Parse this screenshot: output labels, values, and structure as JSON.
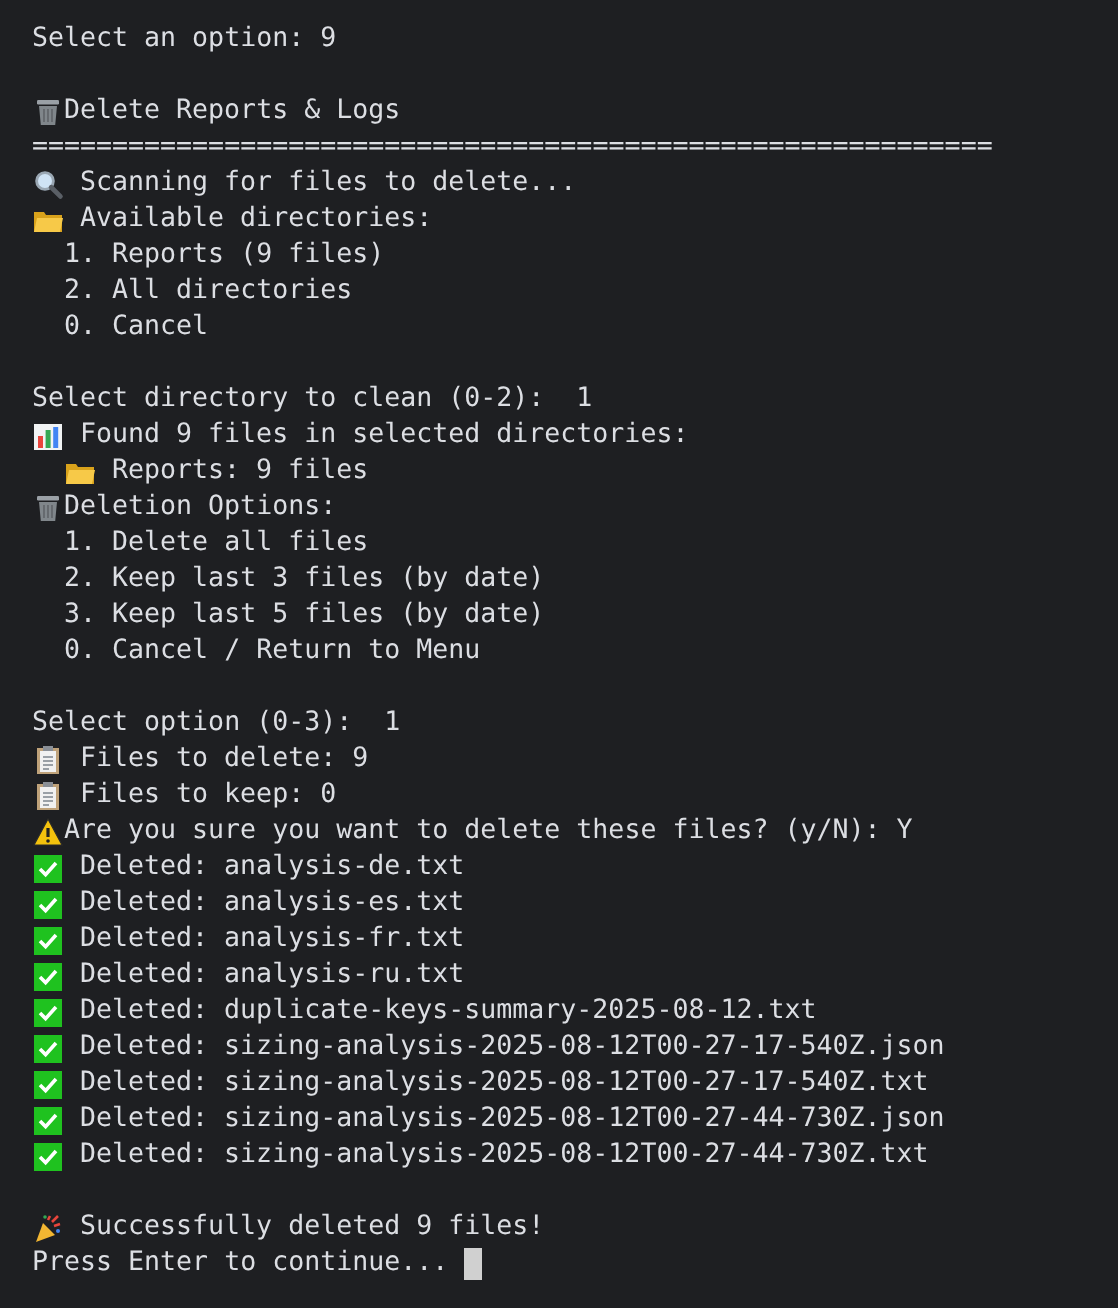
{
  "lines": [
    {
      "kind": "plain",
      "text": "Select an option: 9"
    },
    {
      "kind": "blank"
    },
    {
      "kind": "section",
      "text": "Delete Reports & Logs"
    },
    {
      "kind": "plain",
      "text": "============================================================"
    },
    {
      "kind": "scan",
      "text": "Scanning for files to delete..."
    },
    {
      "kind": "folder",
      "text": "Available directories:"
    },
    {
      "kind": "plain",
      "text": "  1. Reports (9 files)"
    },
    {
      "kind": "plain",
      "text": "  2. All directories"
    },
    {
      "kind": "plain",
      "text": "  0. Cancel"
    },
    {
      "kind": "blank"
    },
    {
      "kind": "plain",
      "text": "Select directory to clean (0-2):  1"
    },
    {
      "kind": "stats",
      "text": "Found 9 files in selected directories:"
    },
    {
      "kind": "subfolder",
      "text": "Reports: 9 files"
    },
    {
      "kind": "section",
      "text": "Deletion Options:"
    },
    {
      "kind": "plain",
      "text": "  1. Delete all files"
    },
    {
      "kind": "plain",
      "text": "  2. Keep last 3 files (by date)"
    },
    {
      "kind": "plain",
      "text": "  3. Keep last 5 files (by date)"
    },
    {
      "kind": "plain",
      "text": "  0. Cancel / Return to Menu"
    },
    {
      "kind": "blank"
    },
    {
      "kind": "plain",
      "text": "Select option (0-3):  1"
    },
    {
      "kind": "list",
      "text": "Files to delete: 9"
    },
    {
      "kind": "list",
      "text": "Files to keep: 0"
    },
    {
      "kind": "warning",
      "text": "Are you sure you want to delete these files? (y/N): Y"
    },
    {
      "kind": "success",
      "text": "Deleted: analysis-de.txt"
    },
    {
      "kind": "success",
      "text": "Deleted: analysis-es.txt"
    },
    {
      "kind": "success",
      "text": "Deleted: analysis-fr.txt"
    },
    {
      "kind": "success",
      "text": "Deleted: analysis-ru.txt"
    },
    {
      "kind": "success",
      "text": "Deleted: duplicate-keys-summary-2025-08-12.txt"
    },
    {
      "kind": "success",
      "text": "Deleted: sizing-analysis-2025-08-12T00-27-17-540Z.json"
    },
    {
      "kind": "success",
      "text": "Deleted: sizing-analysis-2025-08-12T00-27-17-540Z.txt"
    },
    {
      "kind": "success",
      "text": "Deleted: sizing-analysis-2025-08-12T00-27-44-730Z.json"
    },
    {
      "kind": "success",
      "text": "Deleted: sizing-analysis-2025-08-12T00-27-44-730Z.txt"
    },
    {
      "kind": "blank"
    },
    {
      "kind": "celebration",
      "text": "Successfully deleted 9 files!"
    },
    {
      "kind": "prompt",
      "text": "Press Enter to continue..."
    }
  ]
}
